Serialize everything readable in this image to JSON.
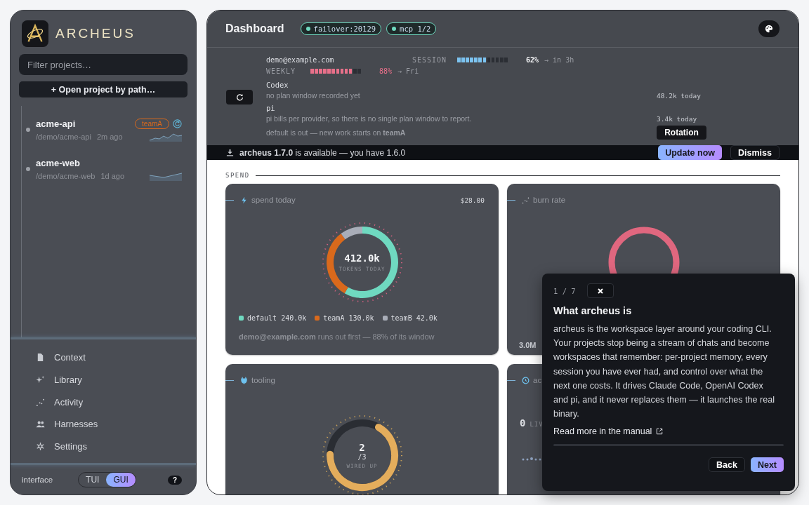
{
  "sidebar": {
    "brand": "ARCHEUS",
    "filter": {
      "placeholder": "Filter projects…"
    },
    "open_button": {
      "icon": "+",
      "label": "Open project by path…"
    },
    "projects": [
      {
        "name": "acme-api",
        "path": "/demo/acme-api",
        "age": "2m ago",
        "badge": "teamA",
        "syncing": true
      },
      {
        "name": "acme-web",
        "path": "/demo/acme-web",
        "age": "1d ago",
        "syncing": false
      }
    ],
    "nav": [
      {
        "label": "Context",
        "kind": "document"
      },
      {
        "label": "Library",
        "kind": "sparkle"
      },
      {
        "label": "Activity",
        "kind": "scatter"
      },
      {
        "label": "Harnesses",
        "kind": "people"
      },
      {
        "label": "Settings",
        "kind": "gear"
      }
    ],
    "footer": {
      "label": "interface",
      "modes": [
        {
          "label": "TUI",
          "selected": false
        },
        {
          "label": "GUI",
          "selected": true
        }
      ],
      "help": "?"
    }
  },
  "header": {
    "title": "Dashboard",
    "pills": [
      "failover:20129",
      "mcp 1/2"
    ]
  },
  "usage": {
    "account": "demo@example.com",
    "session": {
      "label": "SESSION",
      "level": 0.62,
      "percent": "62%",
      "eta": "→ in 3h"
    },
    "weekly": {
      "label": "WEEKLY",
      "level": 0.88,
      "percent": "88%",
      "eta": "→ Fri"
    },
    "providers": [
      {
        "name": "Codex",
        "note": "no plan window recorded yet",
        "today": "48.2k today"
      },
      {
        "name": "pi",
        "note": "pi bills per provider, so there is no single plan window to report.",
        "today": "3.4k today"
      }
    ],
    "footnote": "default is out — new work starts on **teamA**",
    "rotation_button": "Rotation"
  },
  "update_bar": {
    "text": "**archeus 1.7.0** is available — you have 1.6.0",
    "buttons": [
      "Update now",
      "Dismiss"
    ]
  },
  "section": "SPEND",
  "cards": [
    {
      "kind": "spend",
      "title": "spend today",
      "amount": "$28.00",
      "center": "412.0k",
      "caption": "TOKENS TODAY",
      "legend": [
        {
          "value": "240.0k",
          "color": "#6fd9c0"
        },
        {
          "value": "130.0k",
          "color": "#d9691c"
        },
        {
          "value": "42.0k",
          "color": "#a9adb8"
        }
      ],
      "chart_data": {
        "type": "donut",
        "categories": [
          "default",
          "teamA",
          "teamB"
        ],
        "values": [
          58.25,
          31.55,
          10.2
        ]
      },
      "note": "**demo@example.com** runs out first — 88% of its window"
    },
    {
      "kind": "burn",
      "title": "burn rate",
      "value": "3.0M"
    },
    {
      "kind": "tooling",
      "title": "tooling",
      "center": "2",
      "sub": "/3",
      "caption": "WIRED UP",
      "level": 0.67
    },
    {
      "kind": "activity",
      "title": "ac",
      "value": "0",
      "caption": "LIV"
    }
  ],
  "tour": {
    "step": "1 / 7",
    "title": "What archeus is",
    "body": "archeus is the workspace layer around your coding CLI. Your projects stop being a stream of chats and become workspaces that remember: per-project memory, every session you have ever had, and control over what the next one costs. It drives Claude Code, OpenAI Codex and pi, and it never replaces them — it launches the real binary.",
    "link": "Read more in the manual",
    "buttons": [
      "Back",
      "Next"
    ]
  }
}
